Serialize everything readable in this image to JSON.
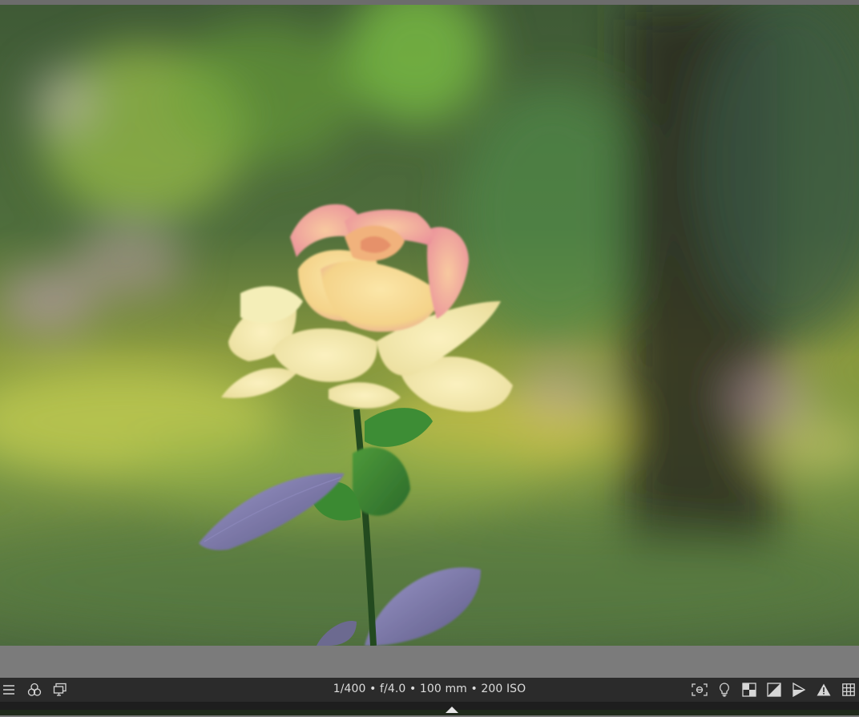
{
  "toolbar": {
    "exif": "1/400 • f/4.0 • 100 mm • 200 ISO",
    "left_icons": [
      "menu-icon",
      "color-labels-icon",
      "display-icon"
    ],
    "right_icons": [
      "focus-peaking-icon",
      "lightbulb-icon",
      "softproof-icon",
      "gamut-check-icon",
      "clipping-icon",
      "warning-icon",
      "grid-icon"
    ]
  },
  "colors": {
    "toolbar_bg": "#2b2b2b",
    "band_gray": "#7b7b7b",
    "icon_fg": "#d6d6d6"
  }
}
